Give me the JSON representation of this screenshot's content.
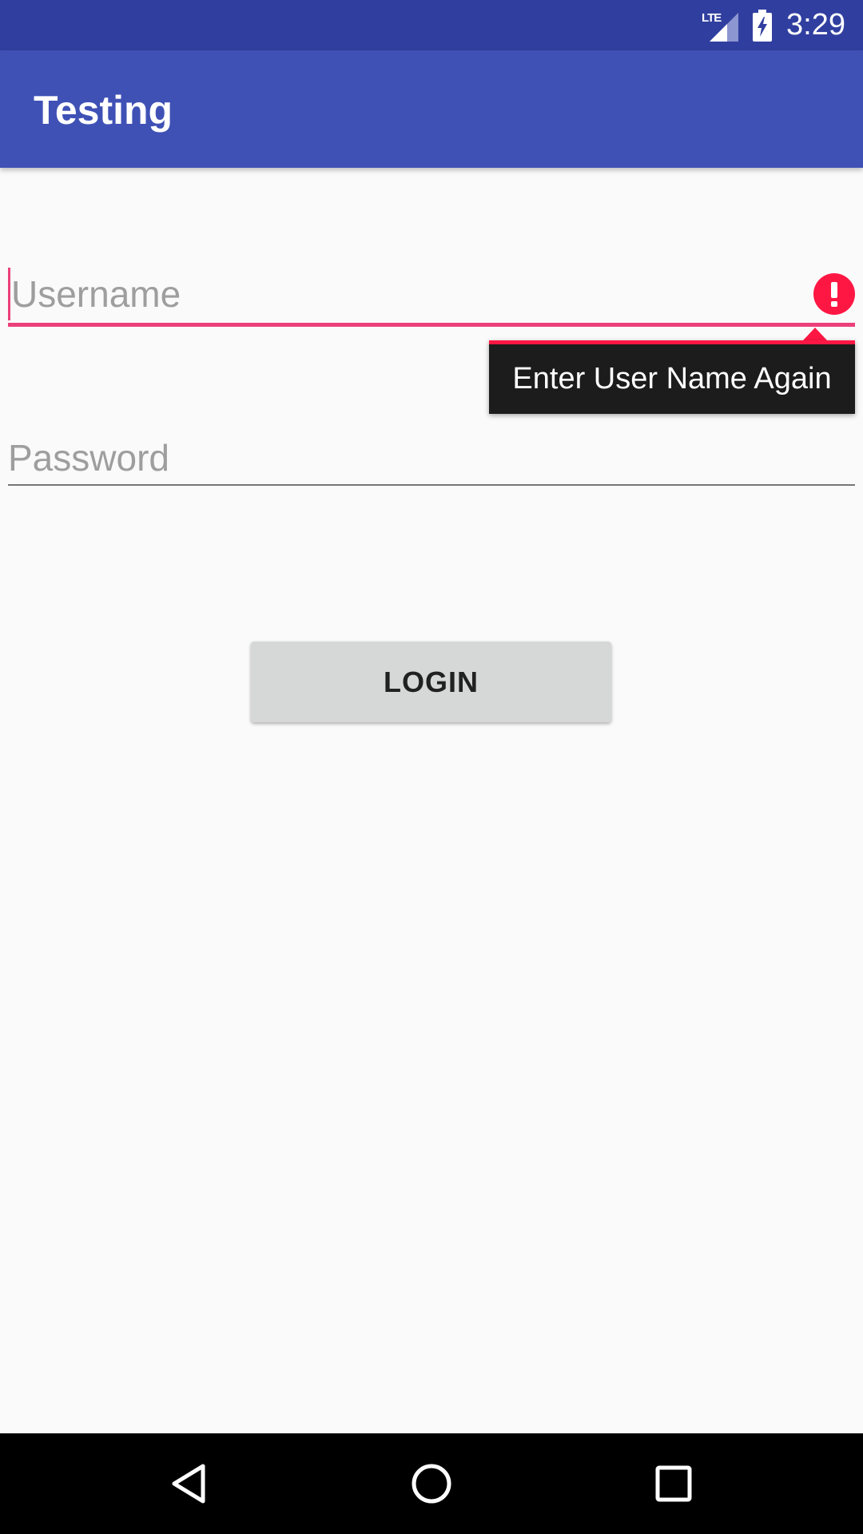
{
  "status_bar": {
    "network_label": "LTE",
    "time": "3:29",
    "icons": [
      "lte-signal-icon",
      "battery-charging-icon"
    ]
  },
  "app_bar": {
    "title": "Testing"
  },
  "form": {
    "username": {
      "value": "",
      "placeholder": "Username",
      "error_message": "Enter User Name Again"
    },
    "password": {
      "value": "",
      "placeholder": "Password"
    },
    "login_label": "LOGIN"
  },
  "nav_bar": {
    "icons": [
      "back-icon",
      "home-icon",
      "recents-icon"
    ]
  },
  "colors": {
    "status_bar": "#303f9f",
    "app_bar": "#3f51b5",
    "accent": "#ec407a",
    "error": "#ff1744",
    "background": "#fafafa",
    "button": "#d6d7d7"
  }
}
